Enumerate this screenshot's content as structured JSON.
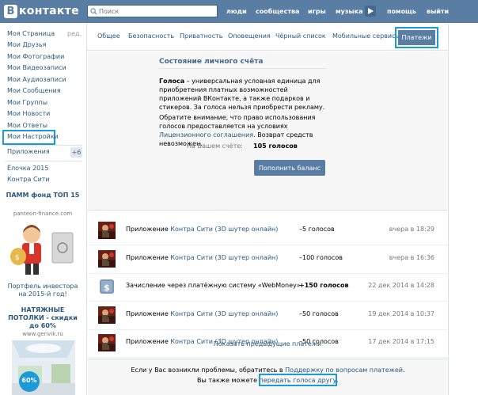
{
  "header": {
    "logo_letter": "В",
    "logo_text": "контакте",
    "search_placeholder": "Поиск",
    "nav": [
      "люди",
      "сообщества",
      "игры",
      "музыка",
      "помощь",
      "выйти"
    ]
  },
  "left_nav": {
    "items": [
      {
        "label": "Моя Страница",
        "extra": "ред."
      },
      {
        "label": "Мои Друзья"
      },
      {
        "label": "Мои Фотографии"
      },
      {
        "label": "Мои Видеозаписи"
      },
      {
        "label": "Мои Аудиозаписи"
      },
      {
        "label": "Мои Сообщения"
      },
      {
        "label": "Мои Группы"
      },
      {
        "label": "Мои Новости"
      },
      {
        "label": "Мои Ответы"
      },
      {
        "label": "Мои Настройки"
      }
    ],
    "apps_label": "Приложения",
    "apps_count": "+6",
    "apps": [
      "Ёлочка 2015",
      "Контра Сити"
    ]
  },
  "ads": [
    {
      "title": "ПАММ фонд ТОП 15",
      "url": "panteon-finance.com",
      "text": "Портфель инвестора на 2015-й год!"
    },
    {
      "title": "НАТЯЖНЫЕ ПОТОЛКИ - скидки до 60%",
      "url": "www.genvik.ru",
      "badge": "60%"
    }
  ],
  "tabs": [
    "Общее",
    "Безопасность",
    "Приватность",
    "Оповещения",
    "Чёрный список",
    "Мобильные сервисы",
    "Платежи"
  ],
  "account": {
    "title": "Состояние личного счёта",
    "desc_bold": "Голоса",
    "desc_rest": " – универсальная условная единица для приобретения платных возможностей приложений ВКонтакте, а также подарков и стикеров. За голоса нельзя приобрести рекламу.",
    "note_pre": "Обратите внимание, что право использования голосов предоставляется на условиях ",
    "note_link": "Лицензионного соглашения",
    "note_post": ". Возврат средств невозможен.",
    "balance_label": "На Вашем счёте:",
    "balance_value": "105 голосов",
    "topup_label": "Пополнить баланс"
  },
  "transactions": [
    {
      "prefix": "Приложение ",
      "link": "Контра Сити (3D шутер онлайн)",
      "suffix": "",
      "amount": "–5 голосов",
      "date": "вчера в 18:29",
      "icon": "app-game-icon",
      "positive": false
    },
    {
      "prefix": "Приложение ",
      "link": "Контра Сити (3D шутер онлайн)",
      "suffix": "",
      "amount": "–100 голосов",
      "date": "вчера в 16:36",
      "icon": "app-game-icon",
      "positive": false
    },
    {
      "prefix": "Зачисление через платёжную систему «WebMoney»",
      "link": "",
      "suffix": "",
      "amount": "+150 голосов",
      "date": "22 дек 2014 в 14:28",
      "icon": "payment-icon",
      "positive": true
    },
    {
      "prefix": "Приложение ",
      "link": "Контра Сити (3D шутер онлайн)",
      "suffix": "",
      "amount": "–50 голосов",
      "date": "19 дек 2014 в 10:37",
      "icon": "app-game-icon",
      "positive": false
    },
    {
      "prefix": "Приложение ",
      "link": "Контра Сити (3D шутер онлайн)",
      "suffix": "",
      "amount": "–50 голосов",
      "date": "17 дек 2014 в 17:15",
      "icon": "app-game-icon",
      "positive": false
    }
  ],
  "show_previous": "Показать предыдущие платежи",
  "footer": {
    "line1_pre": "Если у Вас возникли проблемы, обратитесь в ",
    "line1_link": "Поддержку по вопросам платежей",
    "line1_post": ".",
    "line2_pre": "Вы также можете ",
    "line2_link": "передать голоса другу",
    "line2_post": "."
  },
  "colors": {
    "brand": "#597da3",
    "link": "#2b587a",
    "highlight": "#1a9ad6"
  }
}
